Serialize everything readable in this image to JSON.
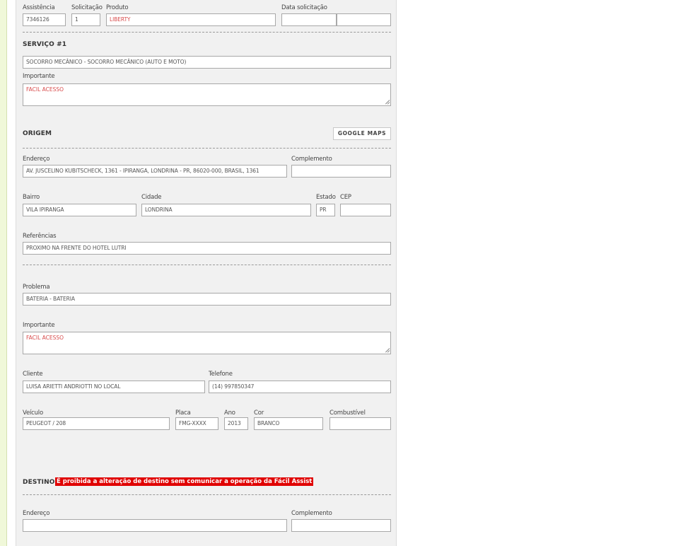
{
  "header": {
    "assistencia": {
      "label": "Assistência",
      "value": "7346126"
    },
    "solicitacao": {
      "label": "Solicitação",
      "value": "1"
    },
    "produto": {
      "label": "Produto",
      "value": "LIBERTY"
    },
    "data_solicitacao": {
      "label": "Data solicitação",
      "date": "",
      "time": ""
    }
  },
  "servico": {
    "title": "SERVIÇO #1",
    "value": "SOCORRO MECÂNICO - SOCORRO MECÂNICO (AUTO E MOTO)",
    "importante_label": "Importante",
    "importante_value": "FACIL ACESSO"
  },
  "origem": {
    "title": "ORIGEM",
    "google_maps_label": "GOOGLE MAPS",
    "endereco_label": "Endereço",
    "endereco_value": "AV. JUSCELINO KUBITSCHECK, 1361 - IPIRANGA, LONDRINA - PR, 86020-000, BRASIL, 1361",
    "complemento_label": "Complemento",
    "complemento_value": "",
    "bairro_label": "Bairro",
    "bairro_value": "VILA IPIRANGA",
    "cidade_label": "Cidade",
    "cidade_value": "LONDRINA",
    "estado_label": "Estado",
    "estado_value": "PR",
    "cep_label": "CEP",
    "cep_value": "",
    "referencias_label": "Referências",
    "referencias_value": "PROXIMO NA FRENTE DO HOTEL LUTRI"
  },
  "problema": {
    "label": "Problema",
    "value": "BATERIA - BATERIA",
    "importante_label": "Importante",
    "importante_value": "FACIL ACESSO"
  },
  "cliente": {
    "label": "Cliente",
    "value": "LUISA ARIETTI ANDRIOTTI NO LOCAL",
    "telefone_label": "Telefone",
    "telefone_value": "(14) 997850347"
  },
  "veiculo": {
    "label": "Veículo",
    "value": "PEUGEOT / 208",
    "placa_label": "Placa",
    "placa_value": "FMG-XXXX",
    "ano_label": "Ano",
    "ano_value": "2013",
    "cor_label": "Cor",
    "cor_value": "BRANCO",
    "combustivel_label": "Combustível",
    "combustivel_value": ""
  },
  "destino": {
    "title": "DESTINO",
    "warning": "É proibida a alteração de destino sem comunicar a operação da Fácil Assist",
    "endereco_label": "Endereço",
    "endereco_value": "",
    "complemento_label": "Complemento",
    "complemento_value": ""
  },
  "colors": {
    "warning_bg": "#e00000",
    "red_text": "#d84b4b",
    "panel_bg": "#f1f1f1"
  }
}
